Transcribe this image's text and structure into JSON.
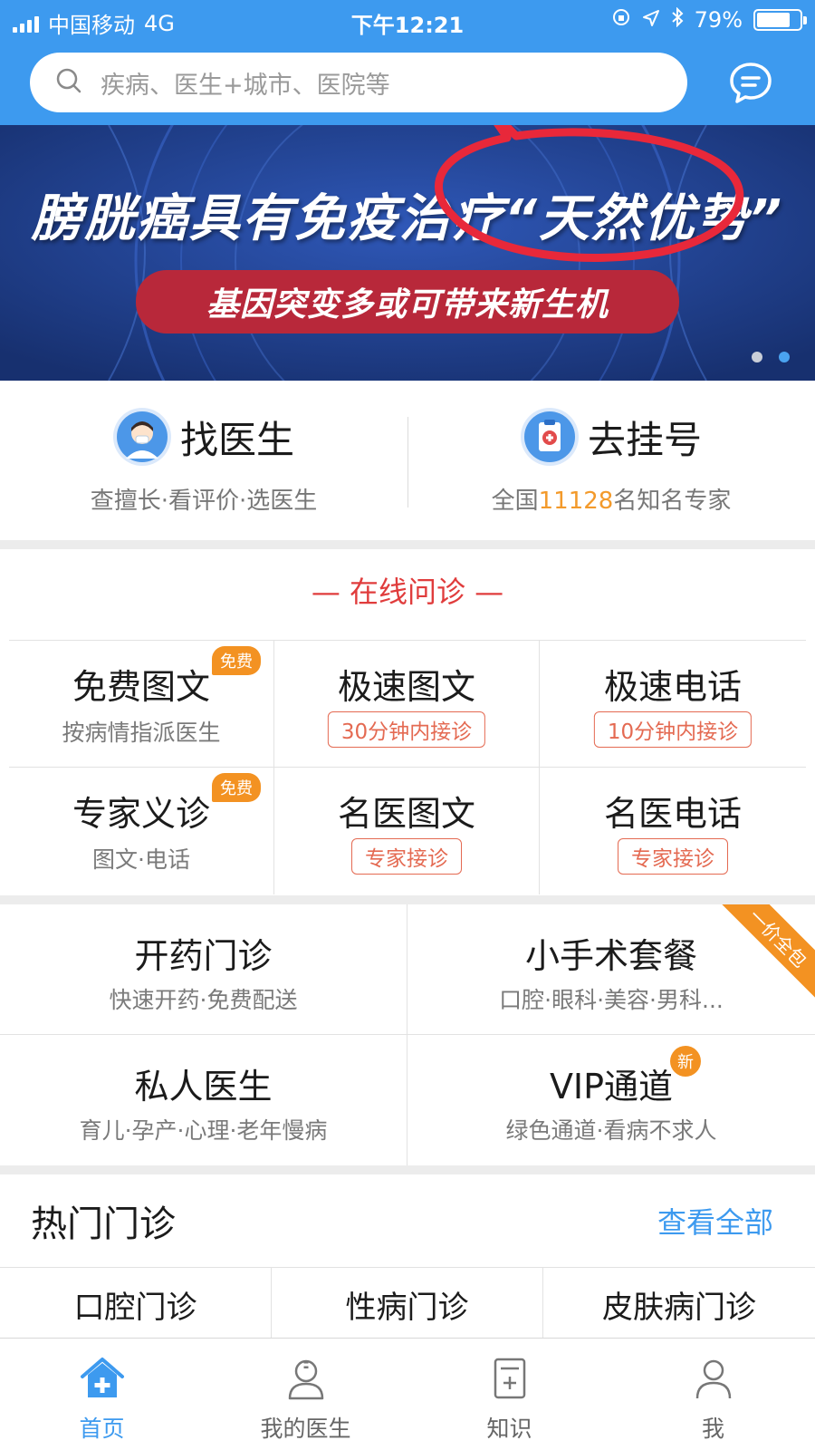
{
  "status_bar": {
    "carrier": "中国移动",
    "network": "4G",
    "time": "下午12:21",
    "battery": "79%",
    "battery_level": 0.79
  },
  "search": {
    "placeholder": "疾病、医生+城市、医院等"
  },
  "banner": {
    "headline": "膀胱癌具有免疫治疗“天然优势”",
    "subline": "基因突变多或可带来新生机",
    "page_count": 2,
    "active_page": 2
  },
  "quick_actions": [
    {
      "title": "找医生",
      "desc": "查擅长·看评价·选医生",
      "icon": "doctor-avatar-icon"
    },
    {
      "title": "去挂号",
      "desc_prefix": "全国",
      "desc_number": "11128",
      "desc_suffix": "名知名专家",
      "icon": "clipboard-plus-icon"
    }
  ],
  "online": {
    "title": "— 在线问诊 —",
    "items": [
      {
        "title": "免费图文",
        "desc": "按病情指派医生",
        "badge": "免费"
      },
      {
        "title": "极速图文",
        "tag": "30分钟内接诊"
      },
      {
        "title": "极速电话",
        "tag": "10分钟内接诊"
      },
      {
        "title": "专家义诊",
        "desc": "图文·电话",
        "badge": "免费"
      },
      {
        "title": "名医图文",
        "tag": "专家接诊"
      },
      {
        "title": "名医电话",
        "tag": "专家接诊"
      }
    ]
  },
  "services": [
    {
      "title": "开药门诊",
      "desc": "快速开药·免费配送"
    },
    {
      "title": "小手术套餐",
      "desc": "口腔·眼科·美容·男科...",
      "ribbon": "一价全包"
    },
    {
      "title": "私人医生",
      "desc": "育儿·孕产·心理·老年慢病"
    },
    {
      "title": "VIP通道",
      "desc": "绿色通道·看病不求人",
      "badge": "新"
    }
  ],
  "hot": {
    "title": "热门门诊",
    "more": "查看全部",
    "items": [
      "口腔门诊",
      "性病门诊",
      "皮肤病门诊"
    ]
  },
  "tabbar": [
    {
      "label": "首页",
      "icon": "home-plus-icon",
      "active": true
    },
    {
      "label": "我的医生",
      "icon": "doctor-icon",
      "active": false
    },
    {
      "label": "知识",
      "icon": "document-plus-icon",
      "active": false
    },
    {
      "label": "我",
      "icon": "user-icon",
      "active": false
    }
  ],
  "colors": {
    "primary": "#3d9aef",
    "accent_orange": "#f39222",
    "accent_red": "#e03c3c",
    "banner_bg": "#1f3d8c"
  }
}
